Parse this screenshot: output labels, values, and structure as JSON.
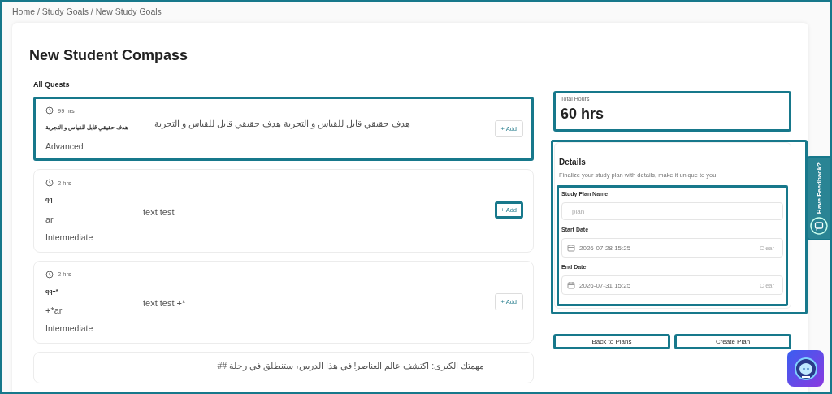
{
  "frame": {
    "highlighted": true
  },
  "breadcrumb": "Home / Study Goals / New Study Goals",
  "title": "New Student Compass",
  "section_title": "All Quests",
  "quests": [
    {
      "hours": "99 hrs",
      "name": "هدف حقيقي قابل للقياس و التجربة",
      "description": "هدف حقيقي قابل للقياس و التجربة هدف حقيقي قابل للقياس و التجربة",
      "level": "Advanced",
      "add_label": "+ Add",
      "highlighted": true,
      "add_highlighted": false
    },
    {
      "hours": "2 hrs",
      "name": "qq",
      "language": "ar",
      "description": "text test",
      "level": "Intermediate",
      "add_label": "+ Add",
      "highlighted": false,
      "add_highlighted": true
    },
    {
      "hours": "2 hrs",
      "name": "qq+*",
      "language": "+*ar",
      "description": "text test +*",
      "level": "Intermediate",
      "add_label": "+ Add",
      "highlighted": false,
      "add_highlighted": false
    },
    {
      "description": "مهمتك الكبرى: اكتشف عالم العناصر! في هذا الدرس، ستنطلق في رحلة ##",
      "highlighted": false
    }
  ],
  "total": {
    "label": "Total Hours",
    "value": "60 hrs",
    "highlighted": true
  },
  "details": {
    "title": "Details",
    "subtitle": "Finalize your study plan with details, make it unique to you!",
    "highlighted": true,
    "fields_highlighted": true,
    "fields": [
      {
        "kind": "text",
        "label": "Study Plan Name",
        "placeholder": "plan"
      },
      {
        "kind": "date",
        "label": "Start Date",
        "value": "2026-07-28 15:25",
        "clear": "Clear"
      },
      {
        "kind": "date",
        "label": "End Date",
        "value": "2026-07-31 15:25",
        "clear": "Clear"
      }
    ]
  },
  "actions": [
    {
      "label": "Back to Plans",
      "highlighted": true
    },
    {
      "label": "Create Plan",
      "highlighted": true
    }
  ],
  "feedback_tab": "Have Feedback?"
}
